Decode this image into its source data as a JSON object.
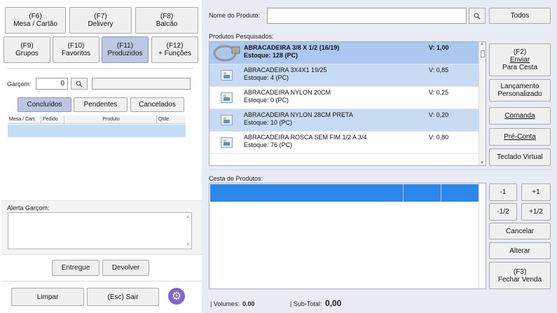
{
  "left": {
    "top_buttons": [
      {
        "key": "(F6)",
        "label": "Mesa / Cartão"
      },
      {
        "key": "(F7)",
        "label": "Delivery"
      },
      {
        "key": "(F8)",
        "label": "Balcão"
      },
      {
        "key": "(F9)",
        "label": "Grupos"
      },
      {
        "key": "(F10)",
        "label": "Favoritos"
      },
      {
        "key": "(F11)",
        "label": "Produzidos"
      },
      {
        "key": "(F12)",
        "label": "+ Funções"
      }
    ],
    "garcom_label": "Garçom:",
    "garcom_value": "0",
    "filter_tabs": [
      "Concluídos",
      "Pendentes",
      "Cancelados"
    ],
    "grid_columns": [
      "Mesa / Cart.",
      "Pedido",
      "Produto",
      "Qtde."
    ],
    "alerta_label": "Alerta Garçom:",
    "entregue": "Entregue",
    "devolver": "Devolver",
    "limpar": "Limpar",
    "sair": "(Esc) Sair"
  },
  "right": {
    "nome_label": "Nome do Produto:",
    "nome_value": "",
    "todos": "Todos",
    "pesquisados_label": "Produtos Pesquisados:",
    "products": [
      {
        "name": "ABRACADEIRA 3/8 X 1/2 (16/19)",
        "stock": "Estoque: 128 (PC)",
        "value": "V: 1,00"
      },
      {
        "name": "ABRACADEIRA 3X4X1 19/25",
        "stock": "Estoque: 4 (PC)",
        "value": "V: 0,85"
      },
      {
        "name": "ABRACADEIRA NYLON 20CM",
        "stock": "Estoque: 0 (PC)",
        "value": "V: 0,25"
      },
      {
        "name": "ABRACADEIRA NYLON 28CM PRETA",
        "stock": "Estoque: 10 (PC)",
        "value": "V: 0,20"
      },
      {
        "name": "ABRACADEIRA ROSCA SEM FIM 1/2 A 3/4",
        "stock": "Estoque: 76 (PC)",
        "value": "V: 0,80"
      }
    ],
    "side_buttons": {
      "enviar_key": "(F2)",
      "enviar_l1": "Enviar",
      "enviar_l2": "Para Cesta",
      "lanc_l1": "Lançamento",
      "lanc_l2": "Personalizado",
      "comanda": "Comanda",
      "preconta": "Pré-Conta",
      "teclado": "Teclado Virtual"
    },
    "cesta_label": "Cesta de Produtos:",
    "qty_buttons": [
      "-1",
      "+1",
      "-1/2",
      "+1/2"
    ],
    "cancelar": "Cancelar",
    "alterar": "Alterar",
    "fechar_key": "(F3)",
    "fechar_label": "Fechar Venda",
    "volumes_label": "| Volumes:",
    "volumes_value": "0.00",
    "subtotal_label": "| Sub-Total:",
    "subtotal_value": "0,00"
  },
  "colors": {
    "accent": "#2b87e8",
    "selected_tab": "#bcc7e3",
    "gear": "#7b68c9"
  }
}
